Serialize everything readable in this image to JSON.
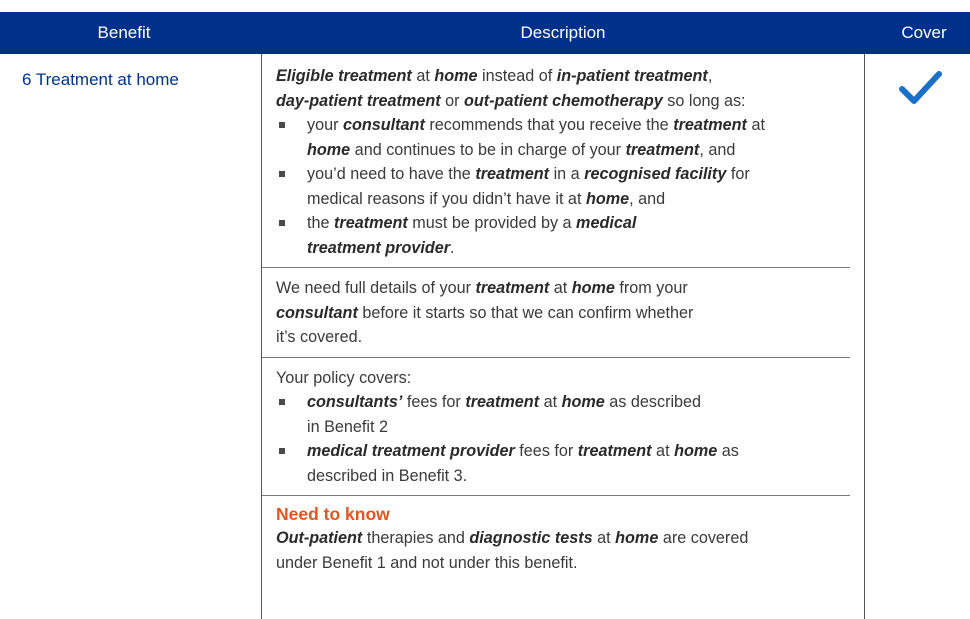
{
  "header": {
    "benefit": "Benefit",
    "description": "Description",
    "cover": "Cover"
  },
  "row": {
    "benefit_name": "6 Treatment at home",
    "cover_icon": "check-mark-icon",
    "intro": {
      "b1": "Eligible treatment",
      "t1": " at ",
      "b2": "home",
      "t2": " instead of ",
      "b3": "in-patient treatment",
      "t3": ",",
      "b4": "day-patient treatment",
      "t4": " or ",
      "b5": "out-patient chemotherapy",
      "t5": " so long as:"
    },
    "conditions": [
      {
        "t1": "your ",
        "b1": "consultant",
        "t2": " recommends that you receive the ",
        "b2": "treatment",
        "t3": " at",
        "b3": "home",
        "t4": " and continues to be in charge of your ",
        "b4": "treatment",
        "t5": ", and"
      },
      {
        "t1": "you’d need to have the ",
        "b1": "treatment",
        "t2": " in a ",
        "b2": "recognised facility",
        "t3": " for",
        "t4": "medical reasons if you didn’t have it at ",
        "b3": "home",
        "t5": ", and"
      },
      {
        "t1": "the ",
        "b1": "treatment",
        "t2": " must be provided by a ",
        "b2": "medical",
        "b3": "treatment provider",
        "t3": "."
      }
    ],
    "details": {
      "t1": "We need full details of your ",
      "b1": "treatment",
      "t2": " at ",
      "b2": "home",
      "t3": " from your",
      "b3": "consultant",
      "t4": " before it starts so that we can confirm whether",
      "t5": "it’s covered."
    },
    "covers_heading": "Your policy covers:",
    "covers": [
      {
        "b1": "consultants’",
        "t1": " fees for ",
        "b2": "treatment",
        "t2": " at ",
        "b3": "home",
        "t3": " as described",
        "t4": "in Benefit 2"
      },
      {
        "b1": "medical treatment provider",
        "t1": " fees for ",
        "b2": "treatment",
        "t2": " at ",
        "b3": "home",
        "t3": " as",
        "t4": "described in Benefit 3."
      }
    ],
    "need_to_know_title": "Need to know",
    "need_to_know": {
      "b1": "Out-patient",
      "t1": " therapies and ",
      "b2": "diagnostic tests",
      "t2": " at ",
      "b3": "home",
      "t3": " are covered",
      "t4": "under Benefit 1 and not under this benefit."
    }
  },
  "colors": {
    "header_bg": "#00318a",
    "benefit_text": "#00318a",
    "check": "#1a6fc9",
    "need_to_know": "#e2561f"
  }
}
